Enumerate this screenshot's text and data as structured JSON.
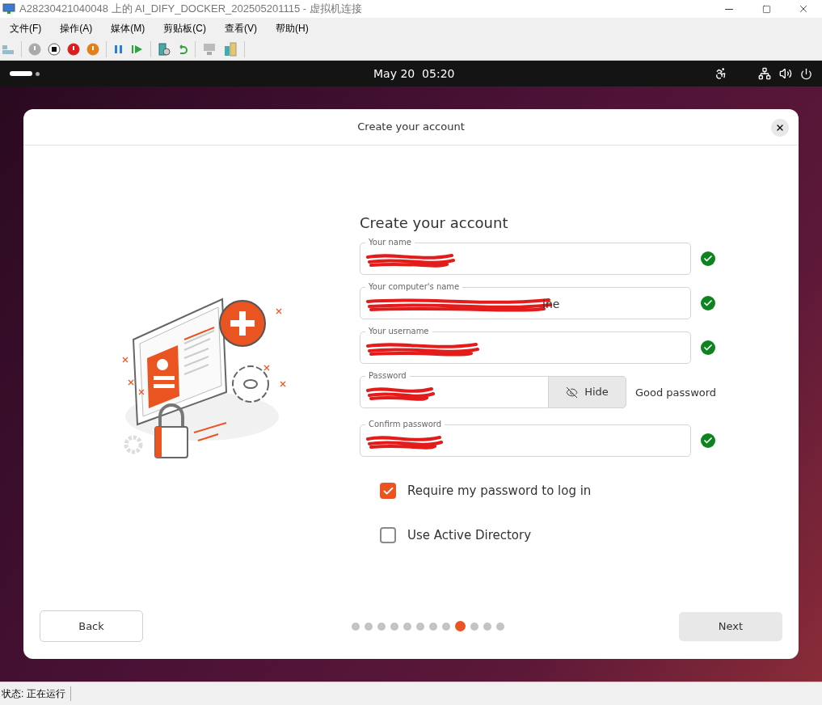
{
  "window": {
    "title": "A28230421040048 上的 AI_DIFY_DOCKER_202505201115 - 虚拟机连接"
  },
  "menu": [
    "文件(F)",
    "操作(A)",
    "媒体(M)",
    "剪贴板(C)",
    "查看(V)",
    "帮助(H)"
  ],
  "top_bar": {
    "clock": "May 20  05:20"
  },
  "dialog": {
    "title": "Create your account",
    "heading": "Create your account",
    "fields": [
      {
        "kind": "text",
        "label": "Your name",
        "redacted": true,
        "valid": true
      },
      {
        "kind": "text",
        "label": "Your computer's name",
        "value": "ine",
        "redacted": true,
        "valid": true
      },
      {
        "kind": "text",
        "label": "Your username",
        "redacted": true,
        "valid": true
      },
      {
        "kind": "password",
        "label": "Password",
        "redacted": true,
        "reveal_button": "Hide",
        "strength": "Good password"
      },
      {
        "kind": "text",
        "label": "Confirm password",
        "redacted": true,
        "valid": true
      }
    ],
    "options": [
      {
        "label": "Require my password to log in",
        "checked": true
      },
      {
        "label": "Use Active Directory",
        "checked": false
      }
    ],
    "back_button": "Back",
    "next_button": "Next",
    "steps": [
      {
        "selected": false
      },
      {
        "selected": false
      },
      {
        "selected": false
      },
      {
        "selected": false
      },
      {
        "selected": false
      },
      {
        "selected": false
      },
      {
        "selected": false
      },
      {
        "selected": false
      },
      {
        "selected": true
      },
      {
        "selected": false
      },
      {
        "selected": false
      },
      {
        "selected": false
      }
    ]
  },
  "status_bar": {
    "text": "状态: 正在运行"
  }
}
